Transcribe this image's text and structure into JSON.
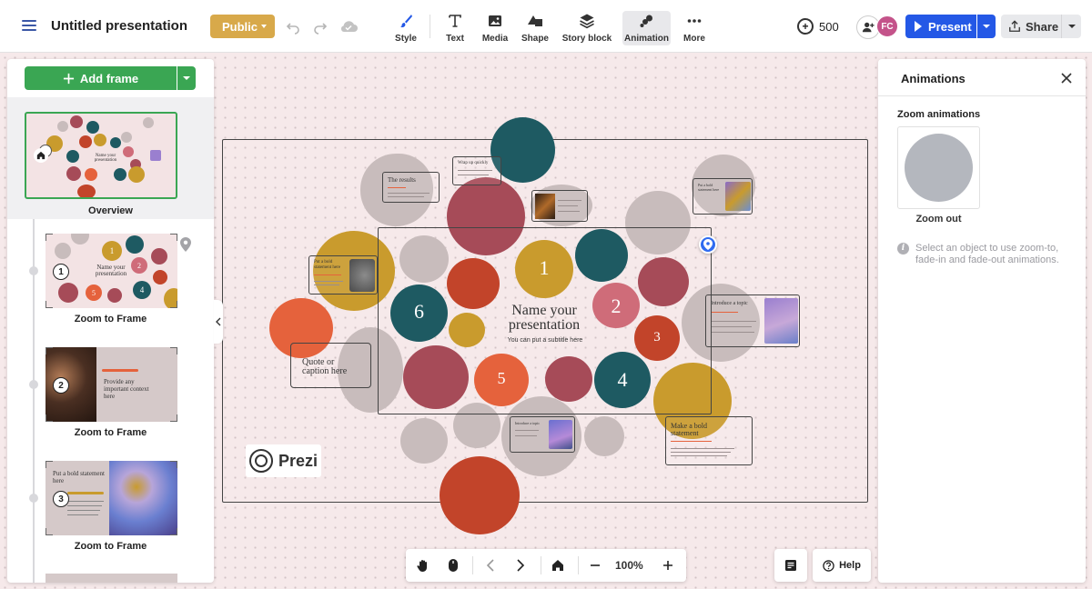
{
  "header": {
    "title": "Untitled presentation",
    "visibility_label": "Public",
    "tools": [
      {
        "name": "style",
        "label": "Style"
      },
      {
        "name": "text",
        "label": "Text"
      },
      {
        "name": "media",
        "label": "Media"
      },
      {
        "name": "shape",
        "label": "Shape"
      },
      {
        "name": "story-block",
        "label": "Story block"
      },
      {
        "name": "animation",
        "label": "Animation",
        "active": true
      },
      {
        "name": "more",
        "label": "More"
      }
    ],
    "credits": "500",
    "avatar_initials": "FC",
    "present_label": "Present",
    "share_label": "Share"
  },
  "sidebar": {
    "add_frame_label": "Add frame",
    "overview_label": "Overview",
    "frames": [
      {
        "number": "1",
        "label": "Zoom to Frame",
        "title": "Name your presentation"
      },
      {
        "number": "2",
        "label": "Zoom to Frame",
        "title": "Provide any important context here"
      },
      {
        "number": "3",
        "label": "Zoom to Frame",
        "title": "Put a bold statement here"
      }
    ]
  },
  "right_panel": {
    "title": "Animations",
    "section_title": "Zoom animations",
    "zoom_out_label": "Zoom out",
    "info_text": "Select an object to use zoom-to, fade-in and fade-out animations."
  },
  "canvas": {
    "main_title": "Name your presentation",
    "main_subtitle": "You can put a subtitle here",
    "quote_text": "Quote or caption here",
    "logo_text": "Prezi",
    "numbers": [
      "1",
      "2",
      "3",
      "4",
      "5",
      "6"
    ],
    "cards": {
      "the_results": "The results",
      "wrap_up": "Wrap up quickly",
      "bold_statement": "Put a bold statement here",
      "introduce_topic": "Introduce a topic",
      "introduce_topic_2": "Introduce a topic",
      "make_bold": "Make a bold statement",
      "bold_statement_2": "Put a bold statement here"
    }
  },
  "bottom_bar": {
    "zoom_level": "100%",
    "help_label": "Help"
  },
  "colors": {
    "teal": "#1e5a62",
    "gold": "#c99b2d",
    "rose": "#a64b58",
    "orange": "#e5623c",
    "pink": "#cf6c79",
    "rust": "#c2442a",
    "gray": "#c8bcbc",
    "present_blue": "#2458e6",
    "add_green": "#3aa653",
    "public_gold": "#d8a94a"
  }
}
